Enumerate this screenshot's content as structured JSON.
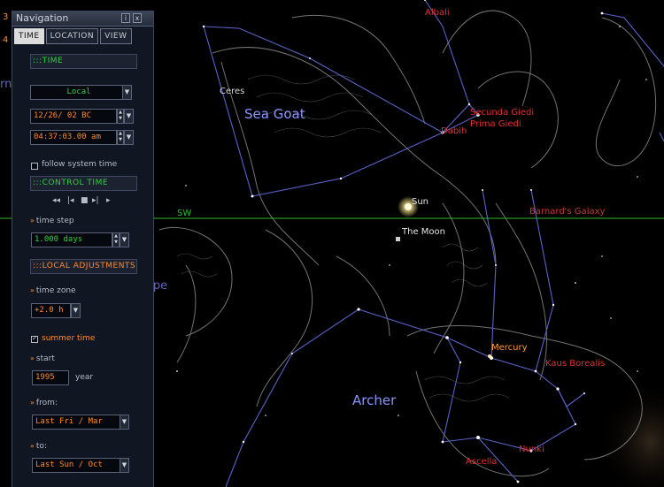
{
  "app": {
    "panel_title": "Navigation",
    "panel_button_labels": [
      "i",
      "x"
    ]
  },
  "tabs": [
    {
      "label": "TIME",
      "active": true
    },
    {
      "label": "LOCATION",
      "active": false
    },
    {
      "label": "VIEW",
      "active": false
    }
  ],
  "time_panel": {
    "section_time": "TIME",
    "timezone_mode": "Local",
    "date": "12/26/  02    BC",
    "time": "04:37:03.00 am",
    "follow_system_time": "follow system time",
    "section_control": "CONTROL TIME",
    "control_icons": [
      "rewind-icon",
      "step-back-icon",
      "stop-icon",
      "step-forward-icon",
      "play-icon"
    ],
    "time_step_label": "time step",
    "time_step_value": "1.000   days",
    "section_local": "LOCAL  ADJUSTMENTS",
    "time_zone_label": "time zone",
    "time_zone_value": "+2.0 h",
    "summer_time_label": "summer time",
    "summer_time_checked": true,
    "start_label": "start",
    "start_year": "1995",
    "year_label": "year",
    "from_label": "from:",
    "from_value": "Last   Fri  /  Mar",
    "to_label": "to:",
    "to_value": "Last   Sun  /  Oct"
  },
  "sky": {
    "constellations": [
      {
        "name": "Sea Goat"
      },
      {
        "name": "Archer"
      },
      {
        "name": "Microscope"
      }
    ],
    "stars": [
      "Albali",
      "Secunda Giedi",
      "Prima Giedi",
      "Dabih"
    ],
    "planets": [
      "Mercury",
      "Ceres"
    ],
    "sun": "Sun",
    "moon": "The Moon",
    "horizon_marker": "SW",
    "galaxy": "Barnard's Galaxy",
    "deep_sky": [
      "Nunki",
      "Ascella",
      "Kaus Borealis"
    ],
    "clipped_left": [
      "3",
      "4",
      "rn Fish"
    ]
  },
  "colors": {
    "constellation_line": "#5a63c8",
    "constellation_name": "#8a95ff",
    "horizon": "#2fb82f",
    "star_label": "#e03030",
    "planet_label": "#ff9a3c",
    "panel_bg": "#101722",
    "panel_green": "#30d040",
    "panel_orange": "#ff8a2a"
  }
}
